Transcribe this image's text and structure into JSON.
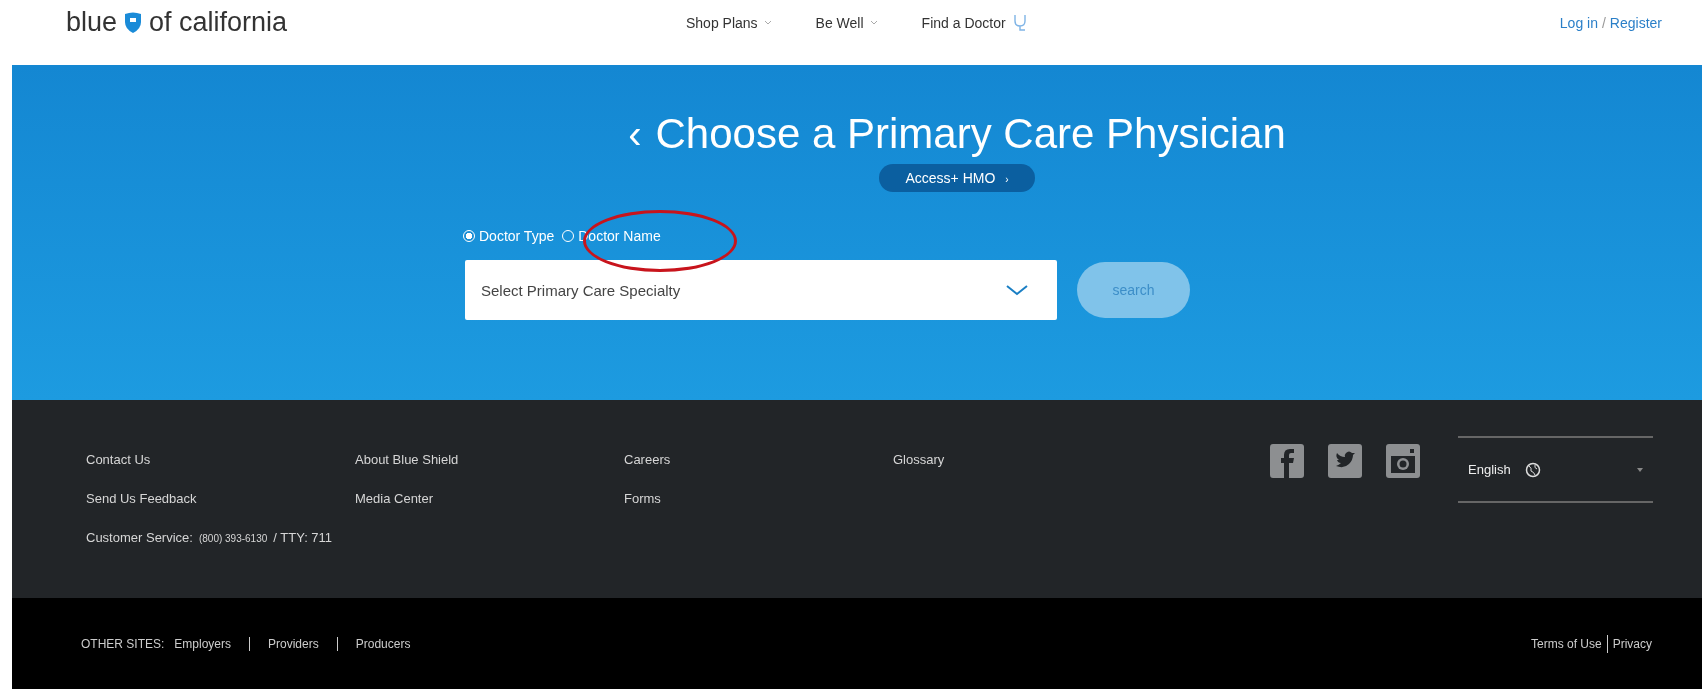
{
  "header": {
    "logo_left": "blue",
    "logo_right": "of california",
    "nav": [
      {
        "label": "Shop Plans",
        "kind": "dropdown"
      },
      {
        "label": "Be Well",
        "kind": "dropdown"
      },
      {
        "label": "Find a Doctor",
        "kind": "doctor"
      }
    ],
    "login": "Log in",
    "register": "Register",
    "login_separator": "/"
  },
  "hero": {
    "back": "‹",
    "title": "Choose a Primary Care Physician",
    "plan": "Access+ HMO",
    "plan_caret": "›",
    "options": [
      {
        "label": "Doctor Type",
        "selected": true
      },
      {
        "label": "Doctor Name",
        "selected": false
      }
    ],
    "select": {
      "placeholder": "Select Primary Care Specialty"
    },
    "search": "search"
  },
  "footer": {
    "links": [
      [
        "Contact Us",
        "Send Us Feedback"
      ],
      [
        "About Blue Shield",
        "Media Center"
      ],
      [
        "Careers",
        "Forms"
      ],
      [
        "Glossary"
      ]
    ],
    "customer_service_label": "Customer Service:",
    "phone": "(800) 393-6130",
    "tty": "/ TTY: 711",
    "language": "English"
  },
  "bottom": {
    "other_sites_label": "OTHER SITES:",
    "sites": [
      "Employers",
      "Providers",
      "Producers"
    ],
    "legal": [
      "Terms of Use",
      "Privacy"
    ]
  }
}
